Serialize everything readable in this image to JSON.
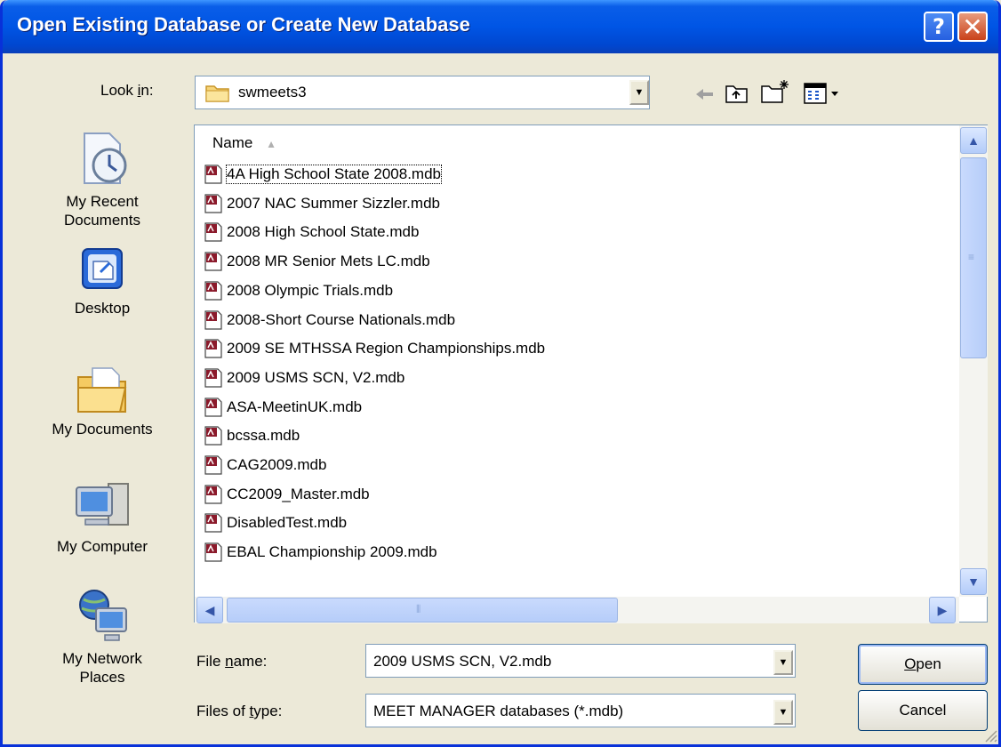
{
  "window": {
    "title": "Open Existing Database or Create New Database",
    "help_glyph": "?",
    "close_glyph": "✕"
  },
  "lookin": {
    "label_pre": "Look ",
    "label_accel": "i",
    "label_post": "n:",
    "value": "swmeets3"
  },
  "toolbar": {
    "icons": [
      "back-arrow-icon",
      "up-folder-icon",
      "new-folder-icon",
      "view-menu-icon"
    ]
  },
  "places": [
    {
      "label_lines": [
        "My Recent",
        "Documents"
      ],
      "icon": "recent-documents-icon"
    },
    {
      "label_lines": [
        "Desktop"
      ],
      "icon": "desktop-icon"
    },
    {
      "label_lines": [
        "My Documents"
      ],
      "icon": "my-documents-icon"
    },
    {
      "label_lines": [
        "My Computer"
      ],
      "icon": "my-computer-icon"
    },
    {
      "label_lines": [
        "My Network",
        "Places"
      ],
      "icon": "network-places-icon"
    }
  ],
  "filelist": {
    "column_name": "Name",
    "sort_indicator": "▲",
    "files": [
      "4A High School State 2008.mdb",
      "2007 NAC Summer Sizzler.mdb",
      "2008 High School State.mdb",
      "2008 MR Senior Mets LC.mdb",
      "2008 Olympic Trials.mdb",
      "2008-Short Course Nationals.mdb",
      "2009 SE MTHSSA Region Championships.mdb",
      "2009 USMS SCN, V2.mdb",
      "ASA-MeetinUK.mdb",
      "bcssa.mdb",
      "CAG2009.mdb",
      "CC2009_Master.mdb",
      "DisabledTest.mdb",
      "EBAL Championship 2009.mdb"
    ],
    "focused_index": 0
  },
  "form": {
    "filename_label_pre": "File ",
    "filename_label_accel": "n",
    "filename_label_post": "ame:",
    "filename_value": "2009 USMS SCN, V2.mdb",
    "filetype_label_pre": "Files of ",
    "filetype_label_accel": "t",
    "filetype_label_post": "ype:",
    "filetype_value": "MEET MANAGER databases (*.mdb)"
  },
  "buttons": {
    "open_accel": "O",
    "open_rest": "pen",
    "cancel": "Cancel"
  },
  "colors": {
    "titlebar": "#0055e5",
    "dialog_bg": "#ece9d8",
    "close_button": "#c9421a"
  }
}
